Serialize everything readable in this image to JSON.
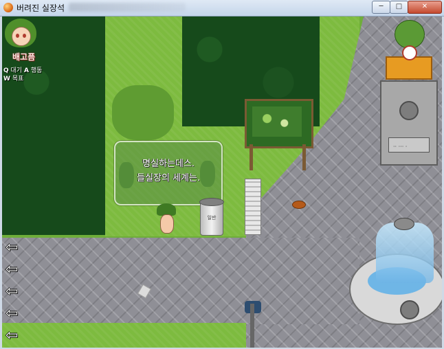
{
  "window": {
    "title": "버려진 실장석",
    "min_symbol": "─",
    "max_symbol": "□",
    "close_symbol": "✕"
  },
  "hud": {
    "status": "배고픔",
    "hints": [
      {
        "key": "Q",
        "label": "대기"
      },
      {
        "key": "A",
        "label": "행동"
      },
      {
        "key": "W",
        "label": "목표"
      }
    ]
  },
  "dialogue": {
    "lines": [
      "명실하는데스.",
      "들실장의 세계는."
    ]
  },
  "trash_can": {
    "label": "일반"
  },
  "statue": {
    "plaque_text": "·· ··· ·"
  },
  "nav": {
    "arrows": [
      "⇦",
      "⇦",
      "⇦",
      "⇦",
      "⇦"
    ]
  },
  "colors": {
    "grass": "#7dbb3f",
    "forest": "#164a1b",
    "path": "#8f8f96",
    "status_text": "#ffeee8"
  }
}
